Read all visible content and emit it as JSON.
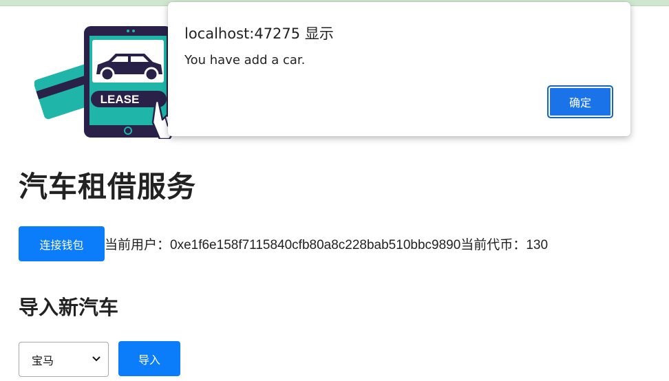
{
  "page": {
    "title": "汽车租借服务",
    "connect_button": "连接钱包",
    "user_label": "当前用户：",
    "user_address": "0xe1f6e158f7115840cfb80a8c228bab510bbc9890",
    "token_label": "当前代币：",
    "token_amount": "130",
    "import_heading": "导入新汽车",
    "car_select": {
      "selected": "宝马"
    },
    "import_button": "导入",
    "hero_sign": "LEASE"
  },
  "dialog": {
    "title": "localhost:47275 显示",
    "message": "You have add a car.",
    "ok_button": "确定"
  },
  "colors": {
    "primary": "#0b7dfb",
    "dialog_button": "#1a73e8",
    "teal": "#1fb5a8",
    "navy": "#2a2149"
  }
}
